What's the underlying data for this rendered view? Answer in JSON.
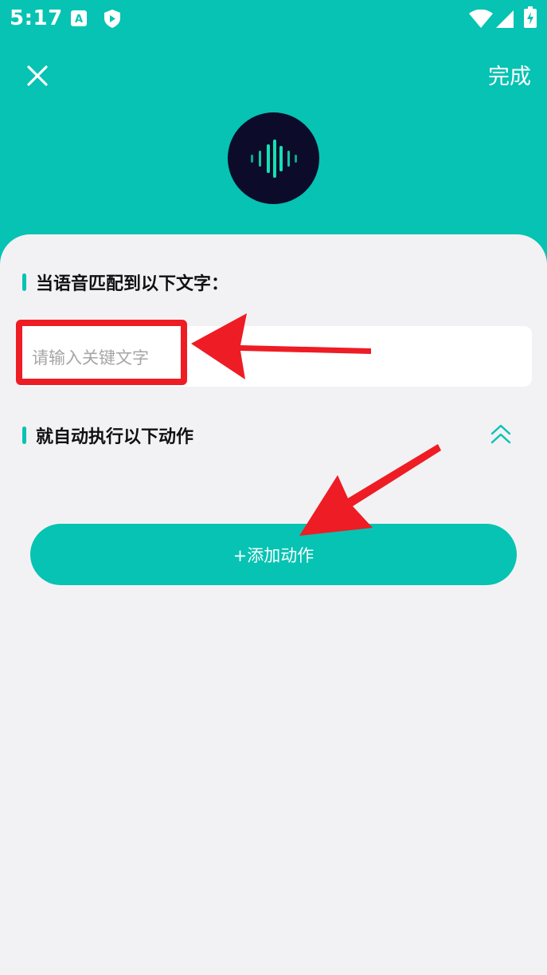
{
  "status_bar": {
    "time": "5:17"
  },
  "header": {
    "done_label": "完成",
    "close_icon": "close-icon",
    "logo_icon": "voice-wave-icon"
  },
  "trigger_section": {
    "title": "当语音匹配到以下文字：",
    "input_placeholder": "请输入关键文字",
    "input_value": ""
  },
  "action_section": {
    "title": "就自动执行以下动作",
    "toggle_icon": "double-chevron-up-icon",
    "add_action_label": "+添加动作"
  },
  "colors": {
    "accent": "#06c3b3",
    "background": "#f2f2f4",
    "logo_bg": "#0c0c2a",
    "annotation_red": "#ee1c24"
  }
}
